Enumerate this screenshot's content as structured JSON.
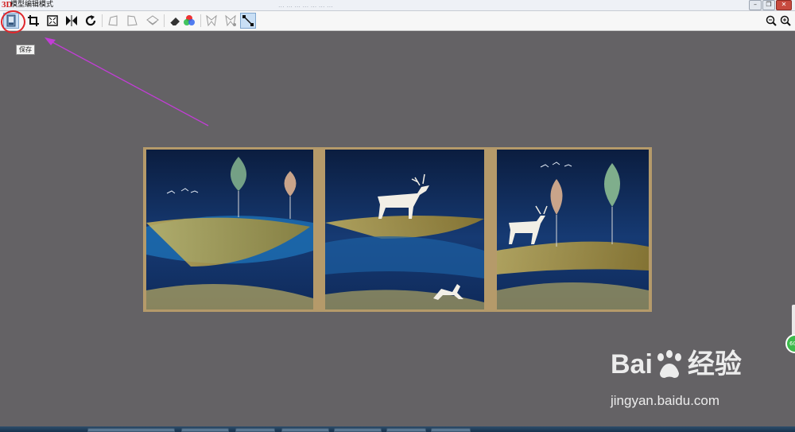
{
  "window": {
    "title": "模型编辑模式",
    "logo": "3D",
    "faint_text": "...  ...  ...  ...  ...  ...  ...",
    "controls": [
      "minimize",
      "restore",
      "close"
    ]
  },
  "toolbar": {
    "left_tools": [
      {
        "id": "save",
        "icon": "save-icon",
        "active": true
      },
      {
        "id": "crop",
        "icon": "crop-icon"
      },
      {
        "id": "fit",
        "icon": "fit-frame-icon"
      },
      {
        "id": "flip",
        "icon": "flip-icon"
      },
      {
        "id": "rotate",
        "icon": "rotate-icon"
      },
      {
        "id": "perspective",
        "icon": "perspective-icon",
        "disabled": true
      },
      {
        "id": "distort",
        "icon": "distort-icon",
        "disabled": true
      },
      {
        "id": "layers",
        "icon": "layers-icon",
        "disabled": true
      },
      {
        "id": "eraser",
        "icon": "eraser-icon"
      },
      {
        "id": "color",
        "icon": "rgb-color-icon"
      },
      {
        "id": "warp-a",
        "icon": "warp-icon",
        "disabled": true
      },
      {
        "id": "warp-b",
        "icon": "warp-icon",
        "disabled": true
      },
      {
        "id": "connect",
        "icon": "connect-points-icon",
        "active": true
      }
    ],
    "right_tools": [
      {
        "id": "zoom-out",
        "icon": "zoom-out-icon"
      },
      {
        "id": "zoom-in",
        "icon": "zoom-in-icon"
      }
    ]
  },
  "tooltip": {
    "text": "保存"
  },
  "annotation": {
    "color": "#c23dd6",
    "circle_color": "#e0262b"
  },
  "canvas": {
    "image_description": "three-panel wall art: deer, leaves, golden waves on dark blue"
  },
  "side_badge": {
    "text": "60"
  },
  "watermark": {
    "logo_text": "Bai",
    "logo_text_2": "经验",
    "url": "jingyan.baidu.com"
  },
  "colors": {
    "canvas_bg": "#646265",
    "accent": "#c9dff5"
  }
}
